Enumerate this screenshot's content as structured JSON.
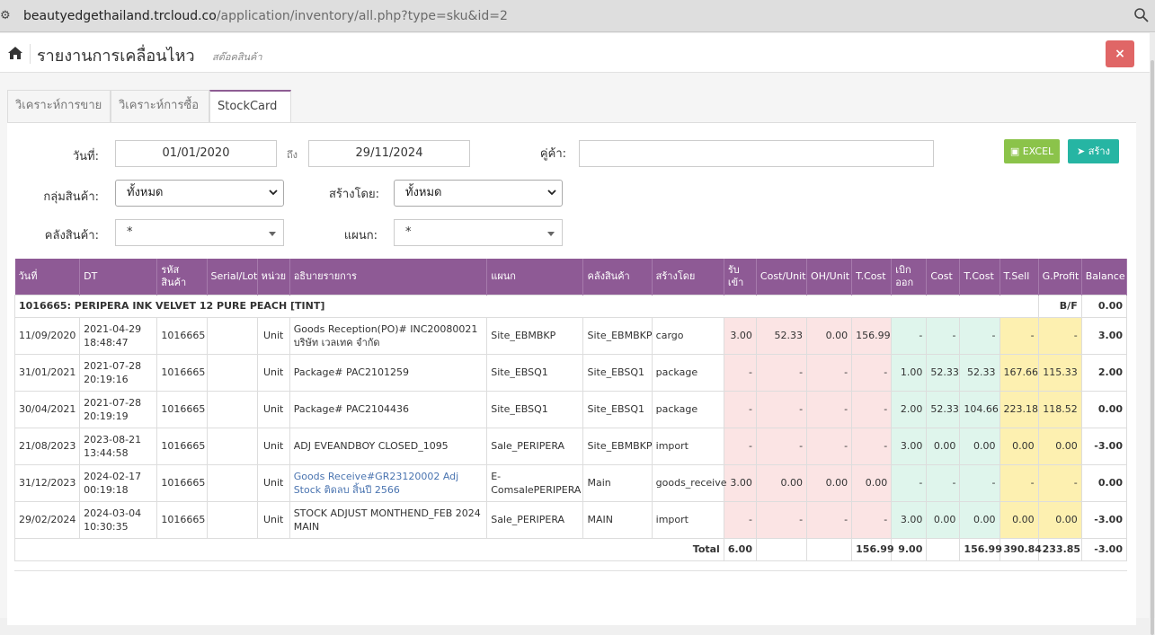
{
  "browser": {
    "url_host": "beautyedgethailand.trcloud.co",
    "url_path": "/application/inventory/all.php?type=sku&id=2"
  },
  "header": {
    "title": "รายงานการเคลื่อนไหว",
    "subtitle": "สต๊อคสินค้า",
    "close_label": "×"
  },
  "tabs": [
    {
      "label": "วิเคราะห์การขาย"
    },
    {
      "label": "วิเคราะห์การซื้อ"
    },
    {
      "label": "StockCard"
    }
  ],
  "filters": {
    "date_label": "วันที่:",
    "date_from": "01/01/2020",
    "to_label": "ถึง",
    "date_to": "29/11/2024",
    "partner_label": "คู่ค้า:",
    "partner_value": "",
    "group_label": "กลุ่มสินค้า:",
    "group_value": "ทั้งหมด",
    "created_by_label": "สร้างโดย:",
    "created_by_value": "ทั้งหมด",
    "warehouse_label": "คลังสินค้า:",
    "warehouse_value": "*",
    "dept_label": "แผนก:",
    "dept_value": "*",
    "excel_label": "EXCEL",
    "create_label": "สร้าง"
  },
  "table": {
    "headers": [
      "วันที่",
      "DT",
      "รหัส สินค้า",
      "Serial/Lot",
      "หน่วย",
      "อธิบายรายการ",
      "แผนก",
      "คลังสินค้า",
      "สร้างโดย",
      "รับ เข้า",
      "Cost/Unit",
      "OH/Unit",
      "T.Cost",
      "เบิก ออก",
      "Cost",
      "T.Cost",
      "T.Sell",
      "G.Profit",
      "Balance"
    ],
    "group_title": "1016665: PERIPERA INK VELVET 12 PURE PEACH [TINT]",
    "bf_label": "B/F",
    "bf_value": "0.00",
    "rows": [
      {
        "date": "11/09/2020",
        "dt": "2021-04-29 18:48:47",
        "code": "1016665",
        "serial": "",
        "unit": "Unit",
        "desc": "Goods Reception(PO)# INC20080021 บริษัท เวลเทค จำกัด",
        "dept": "Site_EBMBKP",
        "wh": "Site_EBMBKP",
        "by": "cargo",
        "in": "3.00",
        "cost_unit": "52.33",
        "oh_unit": "0.00",
        "tcost_in": "156.99",
        "out": "-",
        "cost": "-",
        "tcost_out": "-",
        "tsell": "-",
        "gprofit": "-",
        "balance": "3.00"
      },
      {
        "date": "31/01/2021",
        "dt": "2021-07-28 20:19:16",
        "code": "1016665",
        "serial": "",
        "unit": "Unit",
        "desc": "Package# PAC2101259",
        "dept": "Site_EBSQ1",
        "wh": "Site_EBSQ1",
        "by": "package",
        "in": "-",
        "cost_unit": "-",
        "oh_unit": "-",
        "tcost_in": "-",
        "out": "1.00",
        "cost": "52.33",
        "tcost_out": "52.33",
        "tsell": "167.66",
        "gprofit": "115.33",
        "balance": "2.00"
      },
      {
        "date": "30/04/2021",
        "dt": "2021-07-28 20:19:19",
        "code": "1016665",
        "serial": "",
        "unit": "Unit",
        "desc": "Package# PAC2104436",
        "dept": "Site_EBSQ1",
        "wh": "Site_EBSQ1",
        "by": "package",
        "in": "-",
        "cost_unit": "-",
        "oh_unit": "-",
        "tcost_in": "-",
        "out": "2.00",
        "cost": "52.33",
        "tcost_out": "104.66",
        "tsell": "223.18",
        "gprofit": "118.52",
        "balance": "0.00"
      },
      {
        "date": "21/08/2023",
        "dt": "2023-08-21 13:44:58",
        "code": "1016665",
        "serial": "",
        "unit": "Unit",
        "desc": "ADJ EVEANDBOY CLOSED_1095",
        "dept": "Sale_PERIPERA",
        "wh": "Site_EBMBKP",
        "by": "import",
        "in": "-",
        "cost_unit": "-",
        "oh_unit": "-",
        "tcost_in": "-",
        "out": "3.00",
        "cost": "0.00",
        "tcost_out": "0.00",
        "tsell": "0.00",
        "gprofit": "0.00",
        "balance": "-3.00"
      },
      {
        "date": "31/12/2023",
        "dt": "2024-02-17 00:19:18",
        "code": "1016665",
        "serial": "",
        "unit": "Unit",
        "desc": "Goods Receive#GR23120002 Adj Stock ติดลบ สิ้นปี 2566",
        "dept": "E-ComsalePERIPERA",
        "wh": "Main",
        "by": "goods_receive",
        "in": "3.00",
        "cost_unit": "0.00",
        "oh_unit": "0.00",
        "tcost_in": "0.00",
        "out": "-",
        "cost": "-",
        "tcost_out": "-",
        "tsell": "-",
        "gprofit": "-",
        "balance": "0.00"
      },
      {
        "date": "29/02/2024",
        "dt": "2024-03-04 10:30:35",
        "code": "1016665",
        "serial": "",
        "unit": "Unit",
        "desc": "STOCK ADJUST MONTHEND_FEB 2024 MAIN",
        "dept": "Sale_PERIPERA",
        "wh": "MAIN",
        "by": "import",
        "in": "-",
        "cost_unit": "-",
        "oh_unit": "-",
        "tcost_in": "-",
        "out": "3.00",
        "cost": "0.00",
        "tcost_out": "0.00",
        "tsell": "0.00",
        "gprofit": "0.00",
        "balance": "-3.00"
      }
    ],
    "total": {
      "label": "Total",
      "in": "6.00",
      "tcost_in": "156.99",
      "out": "9.00",
      "tcost_out": "156.99",
      "tsell": "390.84",
      "gprofit": "233.85",
      "balance": "-3.00"
    }
  }
}
